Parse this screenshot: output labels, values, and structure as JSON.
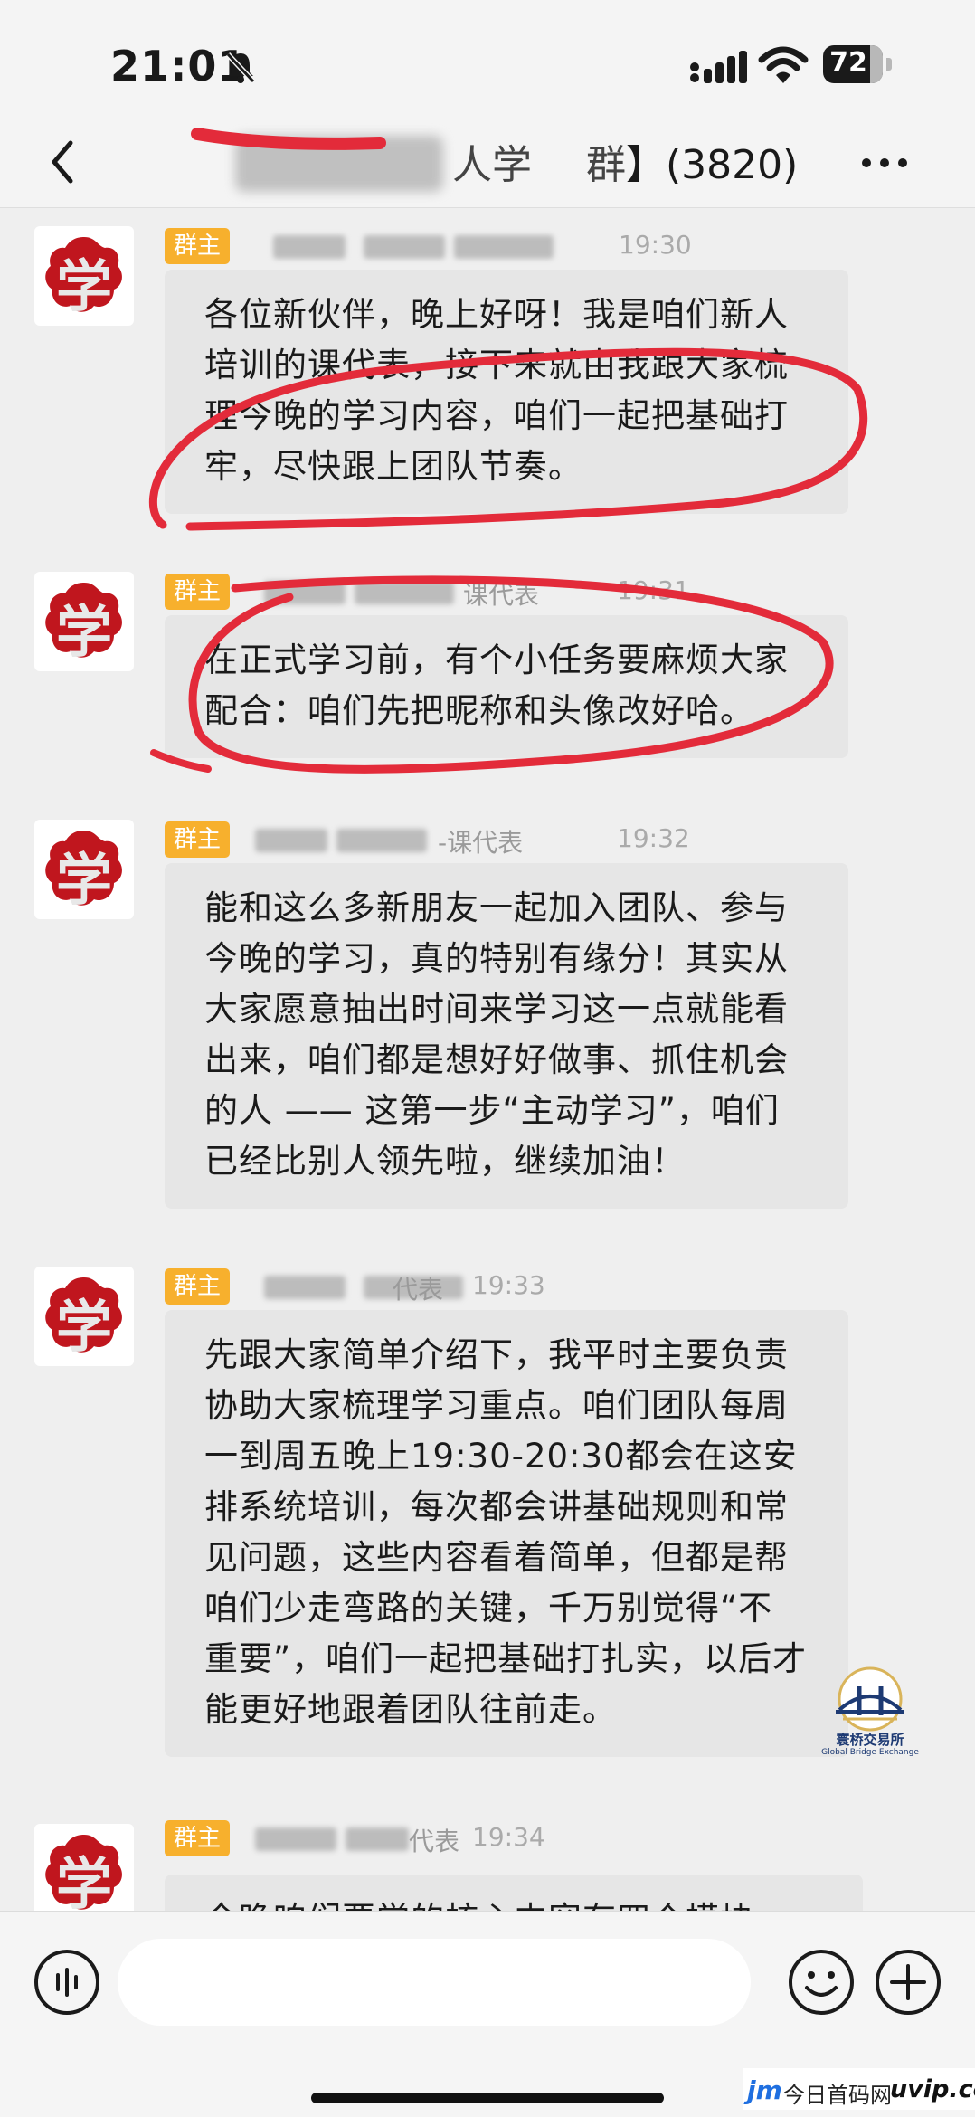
{
  "status_bar": {
    "time": "21:01",
    "battery": "72"
  },
  "header": {
    "title": "】(3820)",
    "title_visible_fragment": "人学",
    "title_visible_fragment2": "群",
    "back_icon": "chevron-left-icon",
    "more_icon": "more-dots-icon"
  },
  "avatar": {
    "char": "学",
    "color": "#c0161e"
  },
  "messages": [
    {
      "badge": "群主",
      "name_suffix": "",
      "time": "19:30",
      "lines": [
        "各位新伙伴，晚上好呀！我是咱们新人",
        "培训的课代表，接下来就由我跟大家梳",
        "理今晚的学习内容，咱们一起把基础打",
        "牢，尽快跟上团队节奏。"
      ]
    },
    {
      "badge": "群主",
      "name_suffix": "课代表",
      "time": "19:31",
      "lines": [
        "在正式学习前，有个小任务要麻烦大家",
        "配合：咱们先把昵称和头像改好哈。"
      ]
    },
    {
      "badge": "群主",
      "name_suffix": "-课代表",
      "time": "19:32",
      "lines": [
        "能和这么多新朋友一起加入团队、参与",
        "今晚的学习，真的特别有缘分！其实从",
        "大家愿意抽出时间来学习这一点就能看",
        "出来，咱们都是想好好做事、抓住机会",
        "的人 —— 这第一步“主动学习”，咱们",
        "已经比别人领先啦，继续加油！"
      ]
    },
    {
      "badge": "群主",
      "name_suffix": "代表",
      "time": "19:33",
      "lines": [
        "先跟大家简单介绍下，我平时主要负责",
        "协助大家梳理学习重点。咱们团队每周",
        "一到周五晚上19:30-20:30都会在这安",
        "排系统培训，每次都会讲基础规则和常",
        "见问题，这些内容看着简单，但都是帮",
        "咱们少走弯路的关键，千万别觉得“不",
        "重要”，咱们一起把基础打扎实，以后才",
        "能更好地跟着团队往前走。"
      ]
    },
    {
      "badge": "群主",
      "name_suffix": "代表",
      "time": "19:34",
      "lines": [
        "今晚咱们要学的核心内容有四个模块"
      ]
    }
  ],
  "input_bar": {
    "placeholder": "",
    "voice_icon": "voice-wave-icon",
    "emoji_icon": "emoji-smile-icon",
    "plus_icon": "plus-circle-icon"
  },
  "watermarks": {
    "bridge_cn": "寰桥交易所",
    "bridge_en": "Global Bridge Exchange",
    "site_logo": "jm",
    "site_cn": "今日首码网",
    "site_en": "uvip.cc"
  },
  "colors": {
    "badge": "#f7b02d",
    "bubble": "#e6e6e6",
    "annotation_red": "#e32b3a"
  }
}
